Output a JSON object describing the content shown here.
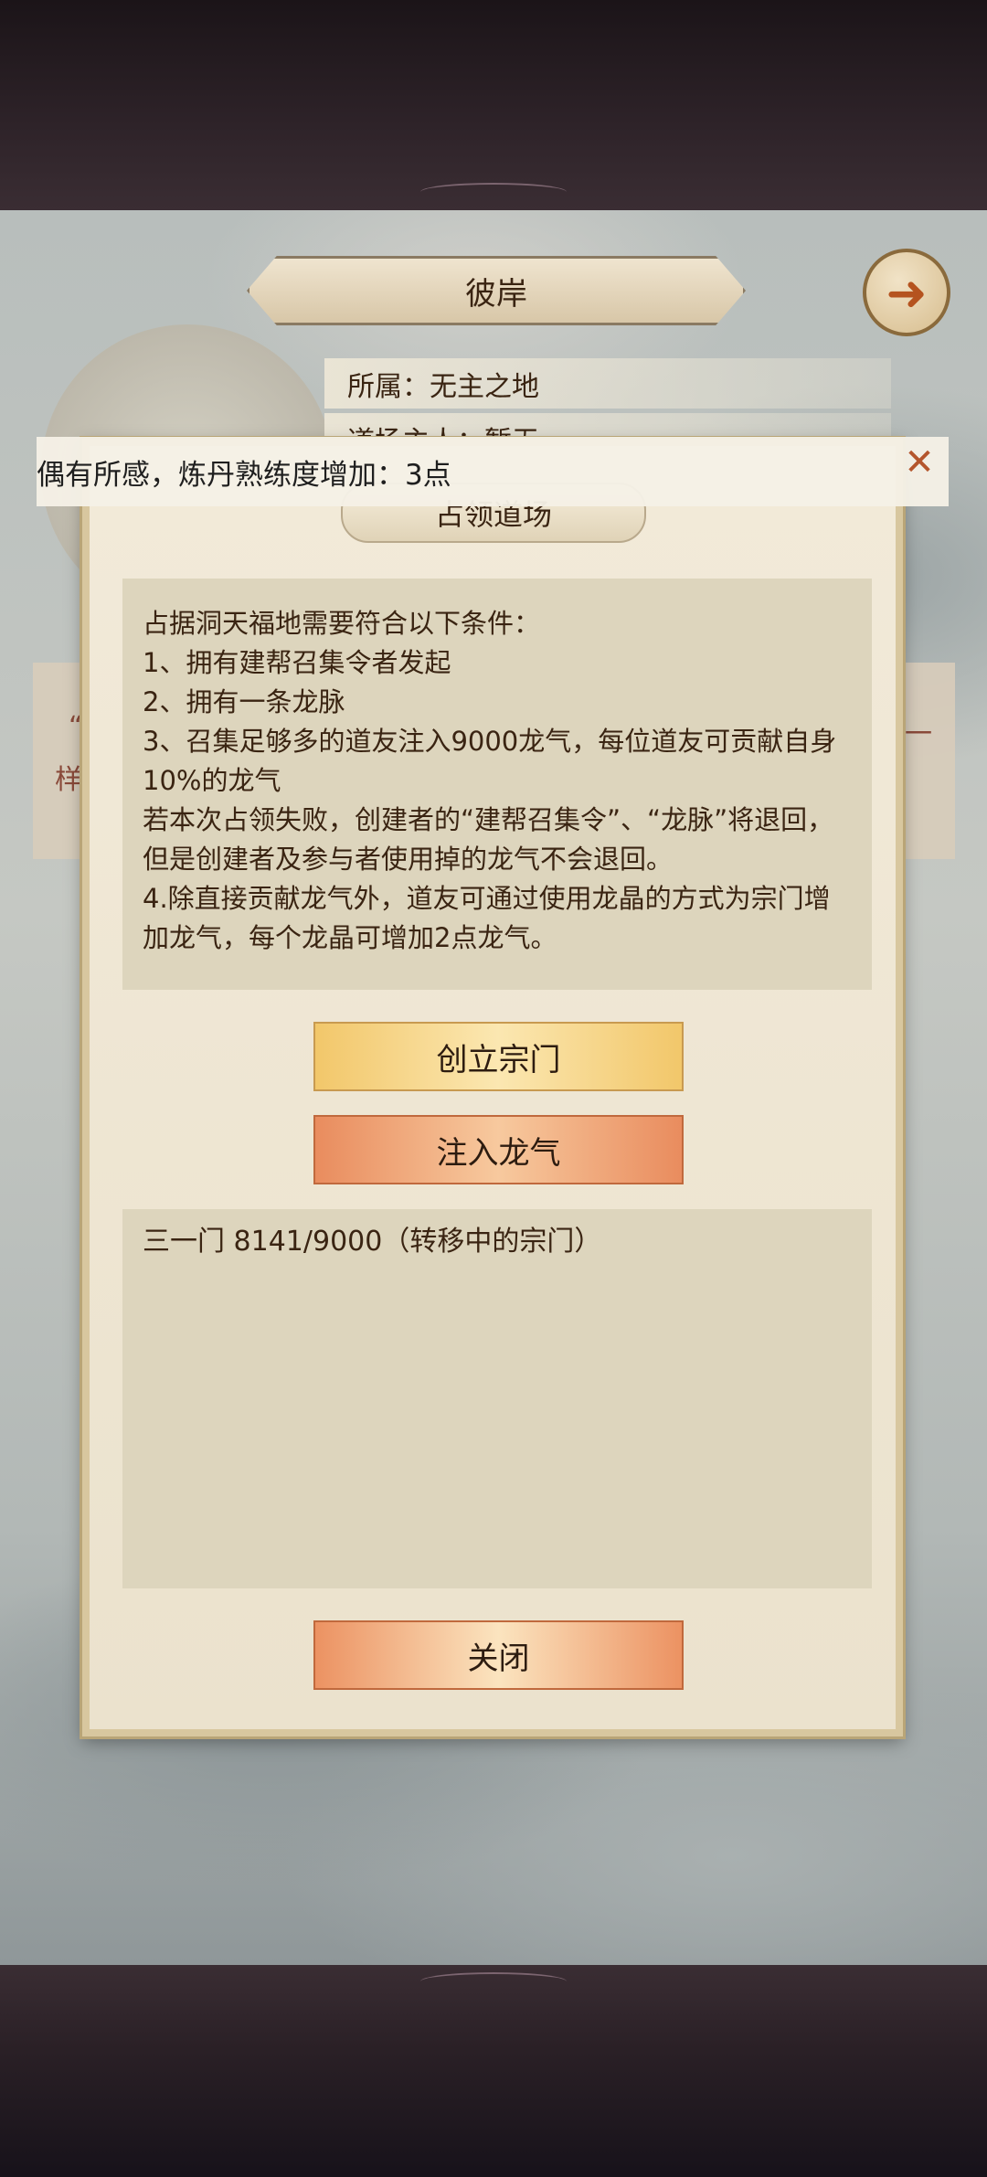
{
  "header": {
    "title": "彼岸"
  },
  "info": {
    "belongs": "所属：无主之地",
    "owner": "道场主人：暂无"
  },
  "side_text": {
    "left_quote": "“",
    "left_char": "样",
    "right_char": "一"
  },
  "toast": {
    "message": "偶有所感，炼丹熟练度增加：3点"
  },
  "dialog": {
    "title": "占领道场",
    "rules": [
      "占据洞天福地需要符合以下条件：",
      "1、拥有建帮召集令者发起",
      "2、拥有一条龙脉",
      "3、召集足够多的道友注入9000龙气，每位道友可贡献自身10%的龙气",
      "若本次占领失败，创建者的“建帮召集令”、“龙脉”将退回，但是创建者及参与者使用掉的龙气不会退回。",
      "4.除直接贡献龙气外，道友可通过使用龙晶的方式为宗门增加龙气，每个龙晶可增加2点龙气。"
    ],
    "create_sect_label": "创立宗门",
    "inject_label": "注入龙气",
    "sect_list": [
      "三一门 8141/9000（转移中的宗门）"
    ],
    "close_label": "关闭"
  },
  "icons": {
    "back": "back-arrow-icon",
    "close": "close-x-icon"
  },
  "colors": {
    "accent_orange": "#e98c5e",
    "accent_gold": "#f2c76a",
    "panel": "#ddd5bd"
  }
}
